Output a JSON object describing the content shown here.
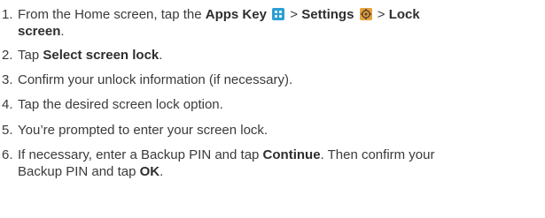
{
  "steps": [
    {
      "num": "1.",
      "t1": "From the Home screen, tap the ",
      "b1": "Apps Key",
      "t2": " > ",
      "b2": "Settings",
      "t3": " > ",
      "b3": "Lock",
      "b3b": "screen",
      "t4": "."
    },
    {
      "num": "2.",
      "t1": "Tap ",
      "b1": "Select screen lock",
      "t2": "."
    },
    {
      "num": "3.",
      "t1": "Confirm your unlock information (if necessary)."
    },
    {
      "num": "4.",
      "t1": "Tap the desired screen lock option."
    },
    {
      "num": "5.",
      "t1": "You’re prompted to enter your screen lock."
    },
    {
      "num": "6.",
      "t1": "If necessary, enter a Backup PIN and tap ",
      "b1": "Continue",
      "t2": ". Then confirm your",
      "t3": "Backup PIN and tap ",
      "b2": "OK",
      "t4": "."
    }
  ],
  "icons": {
    "apps": "apps-grid-icon",
    "settings": "settings-gear-icon"
  },
  "colors": {
    "apps_icon": "#2a9fd6",
    "settings_icon": "#e8a23a"
  }
}
